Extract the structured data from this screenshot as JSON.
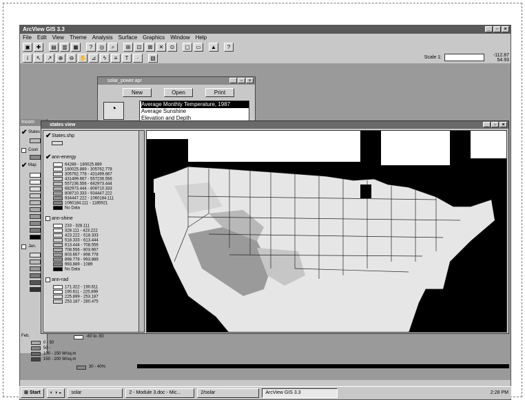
{
  "app": {
    "title": "ArcView GIS 3.3"
  },
  "menu": [
    "File",
    "Edit",
    "View",
    "Theme",
    "Analysis",
    "Surface",
    "Graphics",
    "Window",
    "Help"
  ],
  "toolbar": {
    "scale_label": "Scale 1:",
    "coords": [
      "-112.87",
      "54.93"
    ]
  },
  "project": {
    "title": "solar_power.apr",
    "buttons": [
      "New",
      "Open",
      "Print"
    ],
    "charts": [
      "Average Monthly Temperature, 1987",
      "Average Sunshine",
      "Elevation and Depth"
    ]
  },
  "behind_window": {
    "title": "Incom",
    "items": [
      "States",
      "Coun",
      "Map",
      "Jan."
    ]
  },
  "view": {
    "title": "states view",
    "themes": [
      {
        "name": "States.shp",
        "checked": true,
        "legend": []
      },
      {
        "name": "ann-energy",
        "checked": true,
        "legend": [
          {
            "label": "64288 - 180025.889",
            "color": "#ffffff"
          },
          {
            "label": "180025.889 - 305762.778",
            "color": "#f0f0f0"
          },
          {
            "label": "305762.778 - 431499.667",
            "color": "#e0e0e0"
          },
          {
            "label": "431499.667 - 557236.556",
            "color": "#d0d0d0"
          },
          {
            "label": "557236.556 - 682973.444",
            "color": "#c0c0c0"
          },
          {
            "label": "682973.444 - 808710.333",
            "color": "#b0b0b0"
          },
          {
            "label": "808710.333 - 934447.222",
            "color": "#a0a0a0"
          },
          {
            "label": "934447.222 - 1060184.111",
            "color": "#909090"
          },
          {
            "label": "1060184.111 - 1185921",
            "color": "#808080"
          },
          {
            "label": "No Data",
            "color": "#000000"
          }
        ]
      },
      {
        "name": "ann-shine",
        "checked": false,
        "legend": [
          {
            "label": "233 - 328.111",
            "color": "#ffffff"
          },
          {
            "label": "328.111 - 423.222",
            "color": "#f0f0f0"
          },
          {
            "label": "423.222 - 518.333",
            "color": "#e0e0e0"
          },
          {
            "label": "518.333 - 613.444",
            "color": "#d0d0d0"
          },
          {
            "label": "613.444 - 708.556",
            "color": "#c0c0c0"
          },
          {
            "label": "708.556 - 803.667",
            "color": "#b0b0b0"
          },
          {
            "label": "803.667 - 898.778",
            "color": "#a0a0a0"
          },
          {
            "label": "898.778 - 993.889",
            "color": "#909090"
          },
          {
            "label": "993.889 - 1089",
            "color": "#808080"
          },
          {
            "label": "No Data",
            "color": "#000000"
          }
        ]
      },
      {
        "name": "ann-rad",
        "checked": false,
        "legend": [
          {
            "label": "171.322 - 190.611",
            "color": "#ffffff"
          },
          {
            "label": "190.611 - 225.899",
            "color": "#f0f0f0"
          },
          {
            "label": "225.899 - 253.187",
            "color": "#e0e0e0"
          },
          {
            "label": "253.187 - 280.475",
            "color": "#d0d0d0"
          }
        ]
      }
    ]
  },
  "bottom_legend": {
    "label_top": "Feb.",
    "range": "-60 to -50",
    "items": [
      "0 - 50",
      "50 -",
      "100 - 150 W/sq.m",
      "150 - 200 W/sq.m"
    ],
    "pct": "30 - 40%"
  },
  "taskbar": {
    "start": "Start",
    "tasks": [
      "solar",
      "2 - Module 3.doc - Mic...",
      "2/solar",
      "ArcView GIS 3.3"
    ],
    "clock": "2:28 PM"
  }
}
